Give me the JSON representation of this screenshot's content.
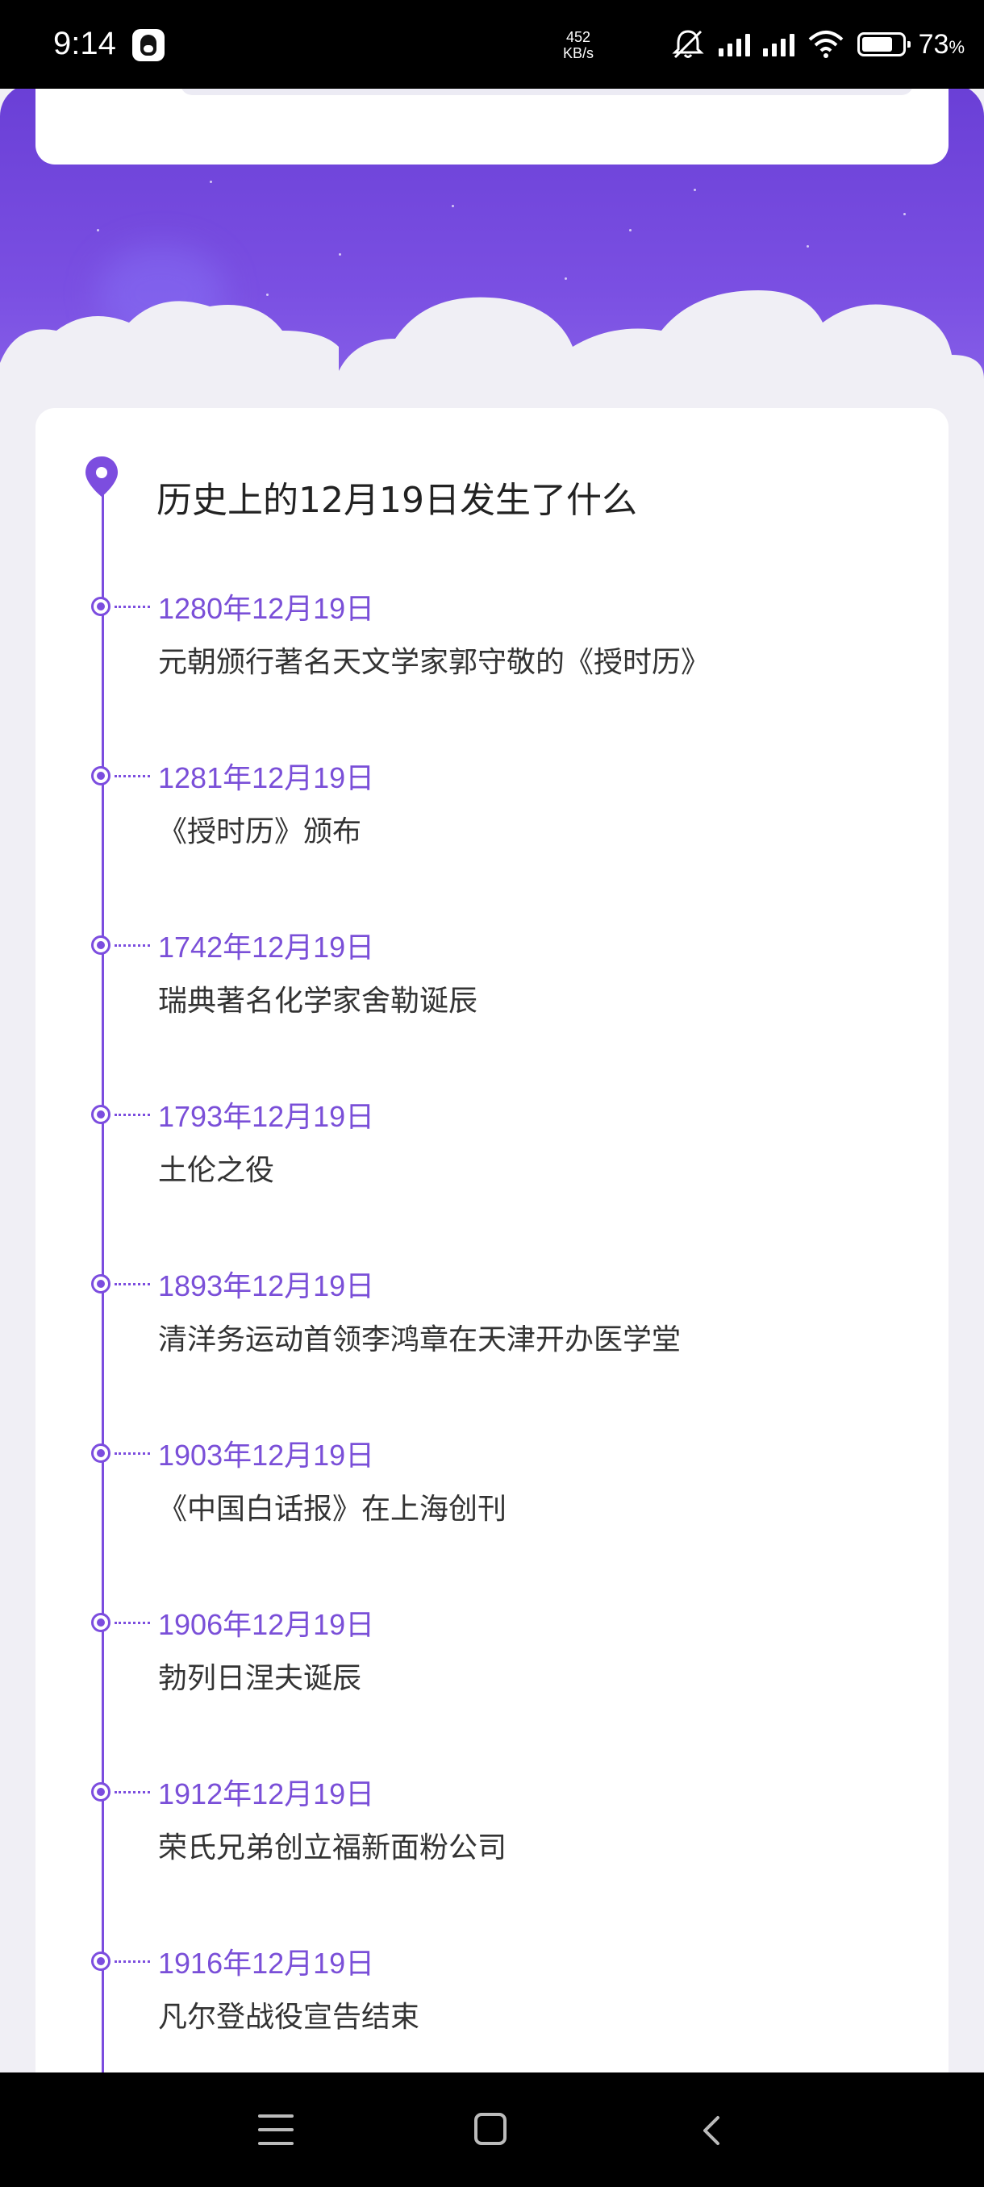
{
  "status_bar": {
    "time": "9:14",
    "net_speed_value": "452",
    "net_speed_unit": "KB/s",
    "battery_percent": "73",
    "battery_suffix": "%",
    "icons": [
      "qq-icon",
      "mute-icon",
      "signal-icon",
      "hd-signal-icon",
      "wifi-icon",
      "battery-icon"
    ]
  },
  "timeline": {
    "title": "历史上的12月19日发生了什么",
    "events": [
      {
        "date": "1280年12月19日",
        "desc": "元朝颁行著名天文学家郭守敬的《授时历》"
      },
      {
        "date": "1281年12月19日",
        "desc": "《授时历》颁布"
      },
      {
        "date": "1742年12月19日",
        "desc": "瑞典著名化学家舍勒诞辰"
      },
      {
        "date": "1793年12月19日",
        "desc": "土伦之役"
      },
      {
        "date": "1893年12月19日",
        "desc": "清洋务运动首领李鸿章在天津开办医学堂"
      },
      {
        "date": "1903年12月19日",
        "desc": "《中国白话报》在上海创刊"
      },
      {
        "date": "1906年12月19日",
        "desc": "勃列日涅夫诞辰"
      },
      {
        "date": "1912年12月19日",
        "desc": "荣氏兄弟创立福新面粉公司"
      },
      {
        "date": "1916年12月19日",
        "desc": "凡尔登战役宣告结束"
      }
    ]
  },
  "colors": {
    "accent": "#7c4ddf",
    "header_purple": "#6a3fd6",
    "background": "#f0eff5"
  },
  "nav_bar": {
    "icons": [
      "menu-icon",
      "home-icon",
      "back-icon"
    ]
  }
}
